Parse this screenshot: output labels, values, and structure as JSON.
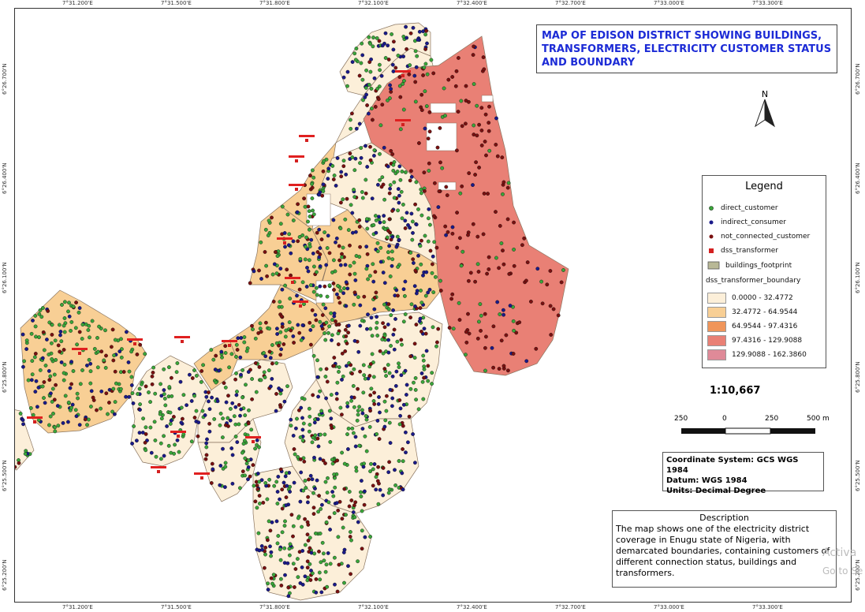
{
  "title": "MAP OF EDISON DISTRICT SHOWING BUILDINGS, TRANSFORMERS, ELECTRICITY CUSTOMER STATUS AND BOUNDARY",
  "title_lines": [
    "MAP OF EDISON DISTRICT SHOWING BUILDINGS,",
    "TRANSFORMERS, ELECTRICITY CUSTOMER STATUS",
    "AND BOUNDARY"
  ],
  "grid": {
    "x_labels": [
      "7°31.200'E",
      "7°31.500'E",
      "7°31.800'E",
      "7°32.100'E",
      "7°32.400'E",
      "7°32.700'E",
      "7°33.000'E",
      "7°33.300'E"
    ],
    "y_labels": [
      "6°26.700'N",
      "6°26.400'N",
      "6°26.100'N",
      "6°25.800'N",
      "6°25.500'N",
      "6°25.200'N"
    ]
  },
  "legend": {
    "title": "Legend",
    "points": [
      {
        "label": "direct_customer",
        "color": "#3aa63a"
      },
      {
        "label": "indirect_consumer",
        "color": "#1a1a8a"
      },
      {
        "label": "not_connected_customer",
        "color": "#7a1010"
      },
      {
        "label": "dss_transformer",
        "color": "#d42020"
      },
      {
        "label": "buildings_footprint",
        "color": "#b8b896"
      }
    ],
    "boundary_title": "dss_transformer_boundary",
    "classes": [
      {
        "label": "0.0000 - 32.4772",
        "color": "#fcefd9"
      },
      {
        "label": "32.4772 - 64.9544",
        "color": "#f8cf95"
      },
      {
        "label": "64.9544 - 97.4316",
        "color": "#f0955a"
      },
      {
        "label": "97.4316 - 129.9088",
        "color": "#e98075"
      },
      {
        "label": "129.9088 - 162.3860",
        "color": "#df8a98"
      }
    ]
  },
  "scale": {
    "text": "1:10,667",
    "labels": [
      "250",
      "0",
      "250",
      "500 m"
    ]
  },
  "north_label": "N",
  "coordinate_info": [
    "Coordinate System: GCS WGS 1984",
    "Datum: WGS 1984",
    "Units: Decimal Degree"
  ],
  "description": {
    "heading": "Description",
    "text": "The map shows one of the electricity district coverage in Enugu state of Nigeria, with demarcated boundaries, containing customers of different connection status, buildings and transformers."
  },
  "watermark": {
    "line1": "Activa",
    "line2": "Go to Se"
  }
}
